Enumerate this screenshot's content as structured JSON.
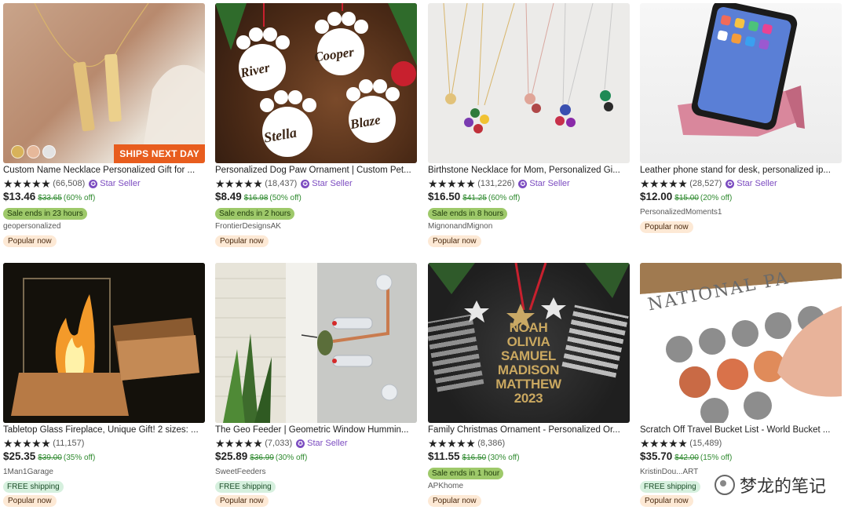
{
  "products": [
    {
      "title": "Custom Name Necklace Personalized Gift for ...",
      "stars": "★★★★★",
      "reviews": "(66,508)",
      "star_seller": "Star Seller",
      "price": "$13.46",
      "original": "$33.65",
      "discount": "(60% off)",
      "badge": "Sale ends in 23 hours",
      "shop": "geopersonalized",
      "popular": "Popular now",
      "overlay": "SHIPS NEXT DAY",
      "swatches": [
        "#d8b25a",
        "#e6b89a",
        "#e3e3e3"
      ]
    },
    {
      "title": "Personalized Dog Paw Ornament | Custom Pet...",
      "stars": "★★★★★",
      "reviews": "(18,437)",
      "star_seller": "Star Seller",
      "price": "$8.49",
      "original": "$16.98",
      "discount": "(50% off)",
      "badge": "Sale ends in 2 hours",
      "shop": "FrontierDesignsAK",
      "popular": "Popular now",
      "paw_names": [
        "River",
        "Cooper",
        "Stella",
        "Blaze"
      ]
    },
    {
      "title": "Birthstone Necklace for Mom, Personalized Gi...",
      "stars": "★★★★★",
      "reviews": "(131,226)",
      "star_seller": "Star Seller",
      "price": "$16.50",
      "original": "$41.25",
      "discount": "(60% off)",
      "badge": "Sale ends in 8 hours",
      "shop": "MignonandMignon",
      "popular": "Popular now"
    },
    {
      "title": "Leather phone stand for desk, personalized ip...",
      "stars": "★★★★★",
      "reviews": "(28,527)",
      "star_seller": "Star Seller",
      "price": "$12.00",
      "original": "$15.00",
      "discount": "(20% off)",
      "shop": "PersonalizedMoments1",
      "popular": "Popular now"
    },
    {
      "title": "Tabletop Glass Fireplace, Unique Gift! 2 sizes: ...",
      "stars": "★★★★★",
      "reviews": "(11,157)",
      "price": "$25.35",
      "original": "$39.00",
      "discount": "(35% off)",
      "shop": "1Man1Garage",
      "free_shipping": "FREE shipping",
      "popular": "Popular now"
    },
    {
      "title": "The Geo Feeder | Geometric Window Hummin...",
      "stars": "★★★★★",
      "reviews": "(7,033)",
      "star_seller": "Star Seller",
      "price": "$25.89",
      "original": "$36.99",
      "discount": "(30% off)",
      "shop": "SweetFeeders",
      "free_shipping": "FREE shipping",
      "popular": "Popular now"
    },
    {
      "title": "Family Christmas Ornament - Personalized Or...",
      "stars": "★★★★★",
      "reviews": "(8,386)",
      "price": "$11.55",
      "original": "$16.50",
      "discount": "(30% off)",
      "badge": "Sale ends in 1 hour",
      "shop": "APKhome",
      "popular": "Popular now",
      "ornament_names": [
        "NOAH",
        "OLIVIA",
        "SAMUEL",
        "MADISON",
        "MATTHEW",
        "2023"
      ]
    },
    {
      "title": "Scratch Off Travel Bucket List - World Bucket ...",
      "stars": "★★★★★",
      "reviews": "(15,489)",
      "price": "$35.70",
      "original": "$42.00",
      "discount": "(15% off)",
      "shop": "KristinDou...ART",
      "free_shipping": "FREE shipping",
      "popular": "Popular now",
      "poster_text": "NATIONAL PA"
    }
  ],
  "watermark": "梦龙的笔记"
}
